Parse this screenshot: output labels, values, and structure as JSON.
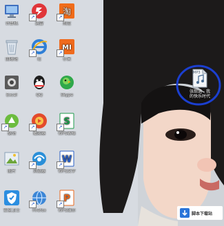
{
  "desktop": {
    "icons": [
      {
        "name": "icon-1",
        "label": "计算机",
        "icon": "computer-icon",
        "color": "#4a7bd0"
      },
      {
        "name": "icon-2",
        "label": "迅雷",
        "icon": "xunlei-icon",
        "color": "#e0363a"
      },
      {
        "name": "icon-3",
        "label": "淘宝",
        "icon": "taobao-icon",
        "color": "#f06c1a"
      },
      {
        "name": "icon-4",
        "label": "回收站",
        "icon": "recycle-bin-icon",
        "color": "#cfd8e2"
      },
      {
        "name": "icon-5",
        "label": "IE",
        "icon": "ie-icon",
        "color": "#2f7fd6"
      },
      {
        "name": "icon-6",
        "label": "小米",
        "icon": "mi-icon",
        "color": "#ef6a1d"
      },
      {
        "name": "icon-7",
        "label": "Excel",
        "icon": "safe-icon",
        "color": "#555555"
      },
      {
        "name": "icon-8",
        "label": "QQ",
        "icon": "qq-icon",
        "color": "#1e1e1e"
      },
      {
        "name": "icon-9",
        "label": "Skype",
        "icon": "parrot-icon",
        "color": "#2fa84a"
      },
      {
        "name": "icon-10",
        "label": "驱动",
        "icon": "drive-icon",
        "color": "#5aa53a"
      },
      {
        "name": "icon-11",
        "label": "播放器",
        "icon": "player-icon",
        "color": "#e34a2c"
      },
      {
        "name": "icon-12",
        "label": "WPS表格",
        "icon": "wps-s-icon",
        "color": "#1f9b4c"
      },
      {
        "name": "icon-13",
        "label": "图片",
        "icon": "picture-icon",
        "color": "#7fb2d8"
      },
      {
        "name": "icon-14",
        "label": "浏览器",
        "icon": "browser-icon",
        "color": "#2a8fd8"
      },
      {
        "name": "icon-15",
        "label": "WPS文字",
        "icon": "wps-w-icon",
        "color": "#2a5fc4"
      },
      {
        "name": "icon-16",
        "label": "安全卫士",
        "icon": "shield-icon",
        "color": "#2b8ee0"
      },
      {
        "name": "icon-17",
        "label": "Firefox",
        "icon": "globe-icon",
        "color": "#3b86d6"
      },
      {
        "name": "icon-18",
        "label": "WPS演示",
        "icon": "wps-p-icon",
        "color": "#e8681f"
      }
    ],
    "mp3_file": {
      "badge": "MP3",
      "label_line1": "张韶涵 - 我",
      "label_line2": "的快乐时代"
    }
  },
  "watermark": {
    "text": "脚本下载站",
    "logo": "download-logo-icon"
  }
}
